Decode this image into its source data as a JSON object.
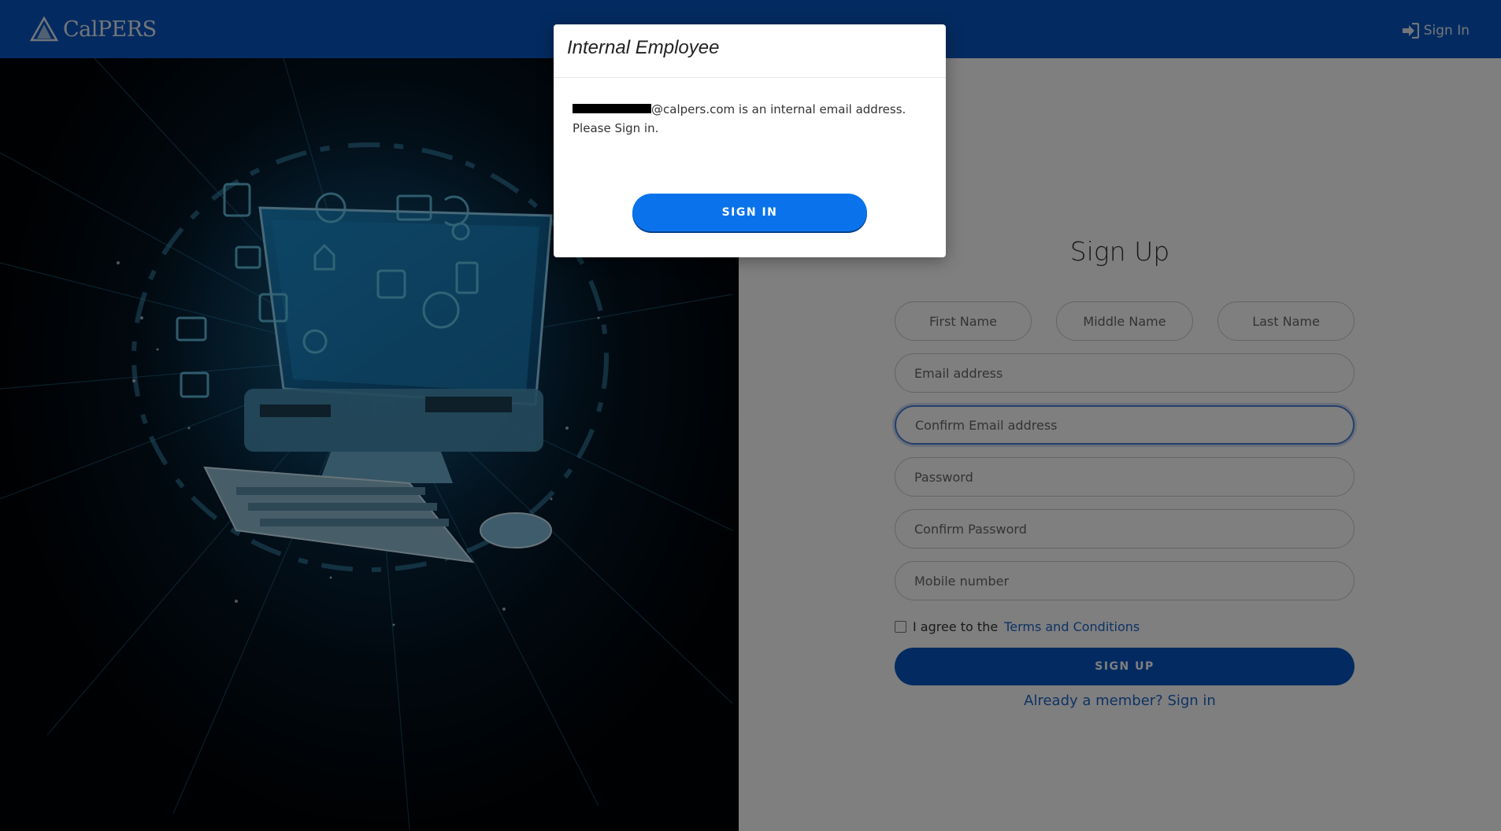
{
  "header": {
    "logo_text": "CalPERS",
    "signin_label": "Sign In",
    "colors": {
      "bar": "#0857c3",
      "text": "#e6ecf6"
    }
  },
  "hero": {
    "icon": "computer-tech-illustration"
  },
  "signup_form": {
    "title": "Sign Up",
    "first_name_placeholder": "First Name",
    "middle_name_placeholder": "Middle Name",
    "last_name_placeholder": "Last Name",
    "email_placeholder": "Email address",
    "confirm_email_placeholder": "Confirm Email address",
    "password_placeholder": "Password",
    "confirm_password_placeholder": "Confirm Password",
    "mobile_placeholder": "Mobile number",
    "agree_prefix": "I agree to the",
    "terms_link": "Terms and Conditions",
    "signup_button": "SIGN UP",
    "already_member_link": "Already a member? Sign in",
    "colors": {
      "primary": "#0857c3",
      "link": "#1b65c9",
      "focus": "#4a7fd6"
    }
  },
  "modal": {
    "title": "Internal Employee",
    "message_domain": "@calpers.com is an internal email address. Please Sign in.",
    "button_label": "SIGN IN",
    "colors": {
      "button": "#0a73ec"
    }
  }
}
